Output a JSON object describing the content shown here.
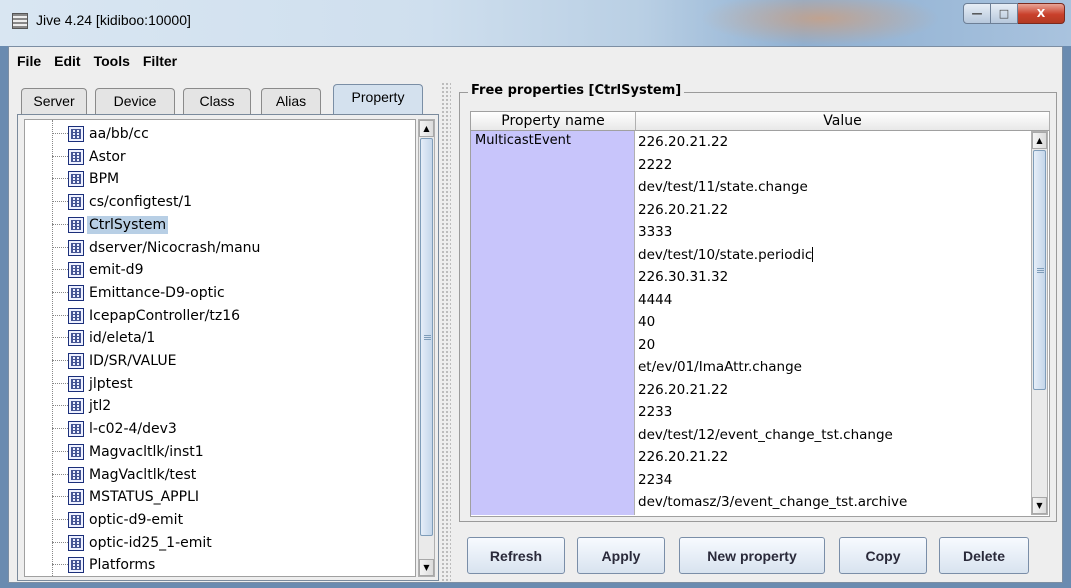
{
  "window": {
    "title": "Jive 4.24  [kidiboo:10000]",
    "minimize_glyph": "—",
    "maximize_glyph": "□",
    "close_glyph": "X"
  },
  "menu": [
    "File",
    "Edit",
    "Tools",
    "Filter"
  ],
  "tabs": [
    "Server",
    "Device",
    "Class",
    "Alias",
    "Property"
  ],
  "active_tab": "Property",
  "tree": {
    "items": [
      "aa/bb/cc",
      "Astor",
      "BPM",
      "cs/configtest/1",
      "CtrlSystem",
      "dserver/Nicocrash/manu",
      "emit-d9",
      "Emittance-D9-optic",
      "IcepapController/tz16",
      "id/eleta/1",
      "ID/SR/VALUE",
      "jlptest",
      "jtl2",
      "l-c02-4/dev3",
      "Magvacltlk/inst1",
      "MagVacltlk/test",
      "MSTATUS_APPLI",
      "optic-d9-emit",
      "optic-id25_1-emit",
      "Platforms"
    ],
    "selected": "CtrlSystem"
  },
  "properties_panel": {
    "title": "Free properties [CtrlSystem]",
    "columns": [
      "Property name",
      "Value"
    ],
    "property_name": "MulticastEvent",
    "values": [
      "226.20.21.22",
      "2222",
      "dev/test/11/state.change",
      "226.20.21.22",
      "3333",
      "dev/test/10/state.periodic",
      "226.30.31.32",
      "4444",
      "40",
      "20",
      "et/ev/01/ImaAttr.change",
      "226.20.21.22",
      "2233",
      "dev/test/12/event_change_tst.change",
      "226.20.21.22",
      "2234",
      "dev/tomasz/3/event_change_tst.archive"
    ]
  },
  "buttons": {
    "refresh": "Refresh",
    "apply": "Apply",
    "new_property": "New property",
    "copy": "Copy",
    "delete": "Delete"
  },
  "scroll_glyphs": {
    "up": "▲",
    "down": "▼"
  }
}
